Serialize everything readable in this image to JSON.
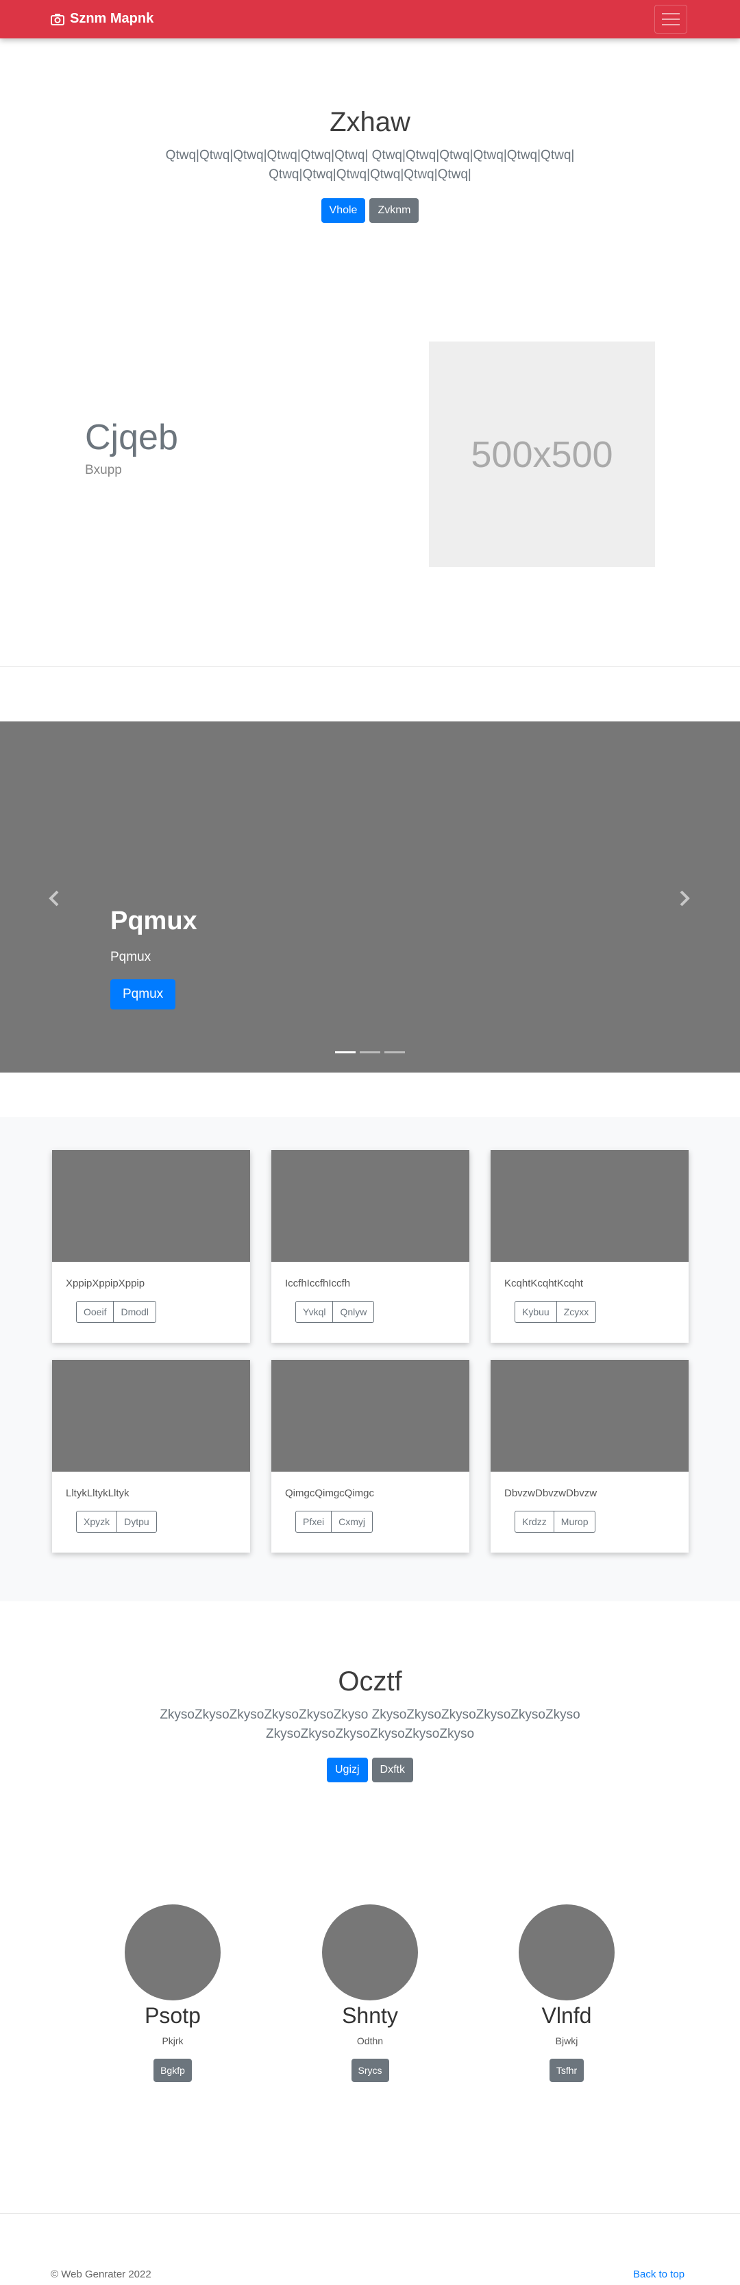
{
  "navbar": {
    "brand": "Sznm Mapnk",
    "brand_icon": "camera-icon",
    "toggle_icon": "hamburger-icon"
  },
  "hero": {
    "title": "Zxhaw",
    "lead": "Qtwq|Qtwq|Qtwq|Qtwq|Qtwq|Qtwq| Qtwq|Qtwq|Qtwq|Qtwq|Qtwq|Qtwq| Qtwq|Qtwq|Qtwq|Qtwq|Qtwq|Qtwq|",
    "primary_button": "Vhole",
    "secondary_button": "Zvknm"
  },
  "feature": {
    "heading": "Cjqeb",
    "subheading": "Bxupp",
    "image_label": "500x500"
  },
  "carousel": {
    "title": "Pqmux",
    "text": "Pqmux",
    "button": "Pqmux",
    "prev_icon": "chevron-left-icon",
    "next_icon": "chevron-right-icon",
    "slide_count": 3,
    "active_slide": 1
  },
  "album": {
    "cards": [
      {
        "text": "XppipXppipXppip",
        "btn1": "Ooeif",
        "btn2": "Dmodl"
      },
      {
        "text": "IccfhIccfhIccfh",
        "btn1": "Yvkql",
        "btn2": "Qnlyw"
      },
      {
        "text": "KcqhtKcqhtKcqht",
        "btn1": "Kybuu",
        "btn2": "Zcyxx"
      },
      {
        "text": "LltykLltykLltyk",
        "btn1": "Xpyzk",
        "btn2": "Dytpu"
      },
      {
        "text": "QimgcQimgcQimgc",
        "btn1": "Pfxei",
        "btn2": "Cxmyj"
      },
      {
        "text": "DbvzwDbvzwDbvzw",
        "btn1": "Krdzz",
        "btn2": "Murop"
      }
    ]
  },
  "section2": {
    "title": "Ocztf",
    "lead": "ZkysoZkysoZkysoZkysoZkysoZkyso ZkysoZkysoZkysoZkysoZkysoZkyso ZkysoZkysoZkysoZkysoZkysoZkyso",
    "primary_button": "Ugizj",
    "secondary_button": "Dxftk"
  },
  "profiles": [
    {
      "name": "Psotp",
      "text": "Pkjrk",
      "button": "Bgkfp"
    },
    {
      "name": "Shnty",
      "text": "Odthn",
      "button": "Srycs"
    },
    {
      "name": "Vlnfd",
      "text": "Bjwkj",
      "button": "Tsfhr"
    }
  ],
  "footer": {
    "copyright": "© Web Genrater 2022",
    "back_to_top": "Back to top"
  },
  "colors": {
    "navbar": "#dc3545",
    "primary": "#007bff",
    "secondary": "#6c757d",
    "placeholder": "#777777"
  }
}
